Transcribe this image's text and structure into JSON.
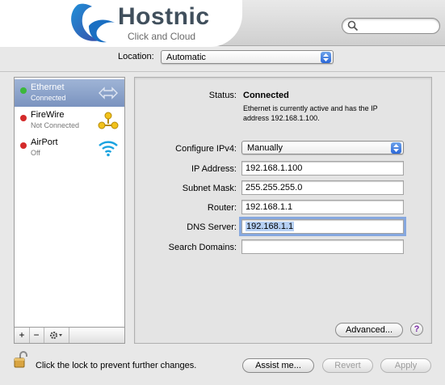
{
  "logo": {
    "name": "Hostnic",
    "tagline": "Click and Cloud"
  },
  "search": {
    "placeholder": ""
  },
  "location": {
    "label": "Location:",
    "value": "Automatic"
  },
  "services": [
    {
      "name": "Ethernet",
      "status": "Connected",
      "dot_color": "#3bb83b",
      "icon": "ethernet-arrows-icon"
    },
    {
      "name": "FireWire",
      "status": "Not Connected",
      "dot_color": "#d42a2a",
      "icon": "firewire-icon"
    },
    {
      "name": "AirPort",
      "status": "Off",
      "dot_color": "#d42a2a",
      "icon": "wifi-icon"
    }
  ],
  "sidebar_controls": {
    "add": "+",
    "remove": "−"
  },
  "panel": {
    "status_label": "Status:",
    "status_value": "Connected",
    "status_desc": "Ethernet is currently active and has the IP address 192.168.1.100.",
    "configure_label": "Configure IPv4:",
    "configure_value": "Manually",
    "ip_label": "IP Address:",
    "ip_value": "192.168.1.100",
    "subnet_label": "Subnet Mask:",
    "subnet_value": "255.255.255.0",
    "router_label": "Router:",
    "router_value": "192.168.1.1",
    "dns_label": "DNS Server:",
    "dns_value": "192.168.1.1",
    "search_domains_label": "Search Domains:",
    "search_domains_value": "",
    "advanced_button": "Advanced...",
    "help_button": "?"
  },
  "footer": {
    "lock_text": "Click the lock to prevent further changes.",
    "assist_button": "Assist me...",
    "revert_button": "Revert",
    "apply_button": "Apply"
  },
  "colors": {
    "accent": "#2b67d8",
    "selection": "#7a93bf",
    "connected": "#3bb83b",
    "disconnected": "#d42a2a"
  }
}
